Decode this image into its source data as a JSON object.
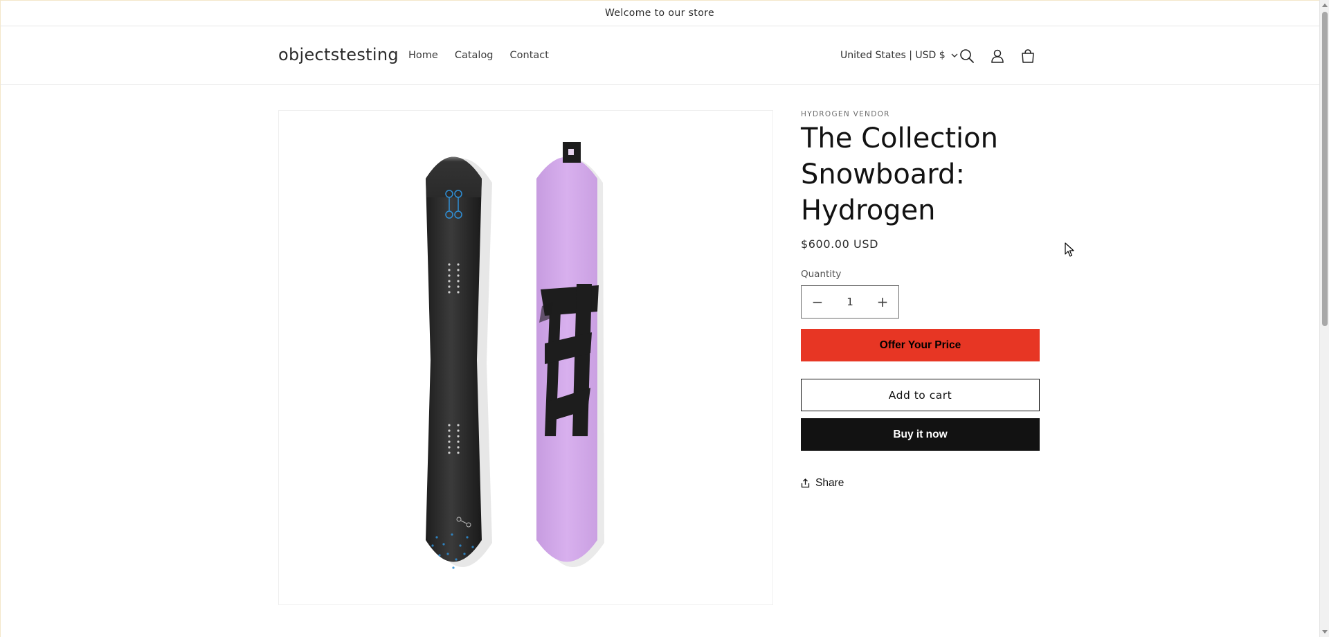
{
  "announcement": {
    "text": "Welcome to our store"
  },
  "header": {
    "logo": "objectstesting",
    "nav": [
      {
        "label": "Home"
      },
      {
        "label": "Catalog"
      },
      {
        "label": "Contact"
      }
    ],
    "locale": "United States | USD $",
    "icons": [
      "search-icon",
      "account-icon",
      "cart-icon"
    ]
  },
  "product": {
    "vendor": "HYDROGEN VENDOR",
    "title": "The Collection Snowboard: Hydrogen",
    "price": "$600.00 USD",
    "quantity_label": "Quantity",
    "quantity_value": "1",
    "minus": "−",
    "plus": "+",
    "offer_label": "Offer Your Price",
    "add_to_cart_label": "Add to cart",
    "buy_now_label": "Buy it now",
    "share_label": "Share"
  },
  "colors": {
    "offer_button": "#e73624",
    "buy_button": "#121212",
    "board_dark": "#2b2b2b",
    "board_purple": "#d3a8e8",
    "accent_blue": "#2f8fd6"
  }
}
